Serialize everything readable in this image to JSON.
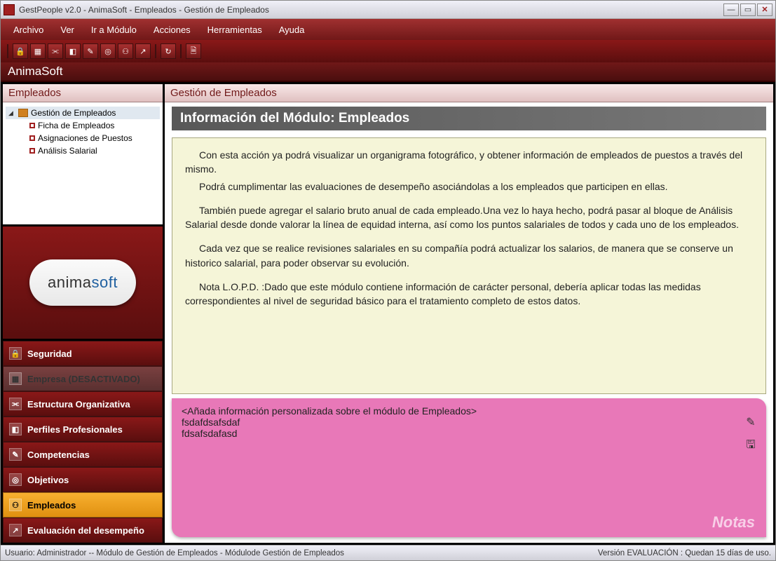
{
  "window": {
    "title": "GestPeople v2.0 - AnimaSoft - Empleados - Gestión de Empleados"
  },
  "menu": {
    "items": [
      "Archivo",
      "Ver",
      "Ir a Módulo",
      "Acciones",
      "Herramientas",
      "Ayuda"
    ]
  },
  "app_header": "AnimaSoft",
  "sidebar": {
    "panel_title": "Empleados",
    "tree": {
      "root": "Gestión de Empleados",
      "children": [
        "Ficha de Empleados",
        "Asignaciones de Puestos",
        "Análisis Salarial"
      ]
    },
    "logo_text_pre": "anima",
    "logo_text_accent": "soft",
    "nav": [
      {
        "label": "Seguridad",
        "state": "normal"
      },
      {
        "label": "Empresa (DESACTIVADO)",
        "state": "disabled"
      },
      {
        "label": "Estructura Organizativa",
        "state": "normal"
      },
      {
        "label": "Perfiles Profesionales",
        "state": "normal"
      },
      {
        "label": "Competencias",
        "state": "normal"
      },
      {
        "label": "Objetivos",
        "state": "normal"
      },
      {
        "label": "Empleados",
        "state": "active"
      },
      {
        "label": "Evaluación del desempeño",
        "state": "normal"
      }
    ]
  },
  "content": {
    "header": "Gestión de Empleados",
    "module_title": "Información del Módulo:  Empleados",
    "info_paragraphs": [
      "Con esta acción ya podrá visualizar un organigrama fotográfico, y obtener información de empleados de puestos a través del mismo.",
      "Podrá cumplimentar las evaluaciones de desempeño asociándolas a los empleados que participen en ellas.",
      "También puede agregar el salario bruto anual de cada empleado.Una vez lo haya hecho, podrá pasar al bloque de Análisis Salarial desde donde valorar la línea de equidad interna, así como los puntos salariales de todos y cada uno de los empleados.",
      "Cada vez que se realice revisiones salariales en su compañía podrá actualizar los salarios, de manera que se conserve un historico salarial, para poder observar su evolución.",
      "Nota L.O.P.D. :Dado que este módulo contiene información de carácter personal, debería aplicar todas las medidas correspondientes al nivel de seguridad básico para el tratamiento completo de estos datos."
    ],
    "notes": {
      "lines": [
        "<Añada información personalizada sobre el módulo de Empleados>",
        "fsdafdsafsdaf",
        "fdsafsdafasd"
      ],
      "label": "Notas"
    }
  },
  "status": {
    "left": "Usuario: Administrador -- Módulo de Gestión de Empleados  -  Módulode Gestión de Empleados",
    "right": "Versión EVALUACIÓN : Quedan 15 días de uso."
  }
}
